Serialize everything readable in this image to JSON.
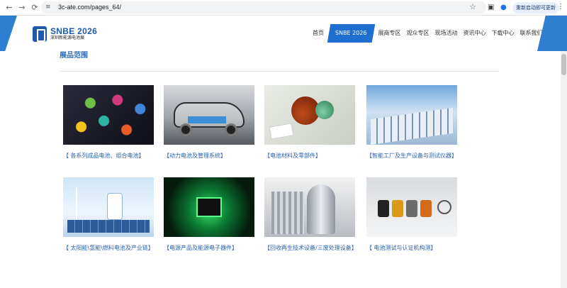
{
  "browser": {
    "back_icon": "←",
    "forward_icon": "→",
    "reload_icon": "⟳",
    "url": "3c-ate.com/pages_64/",
    "site_info_icon": "≡",
    "bookmark_icon": "☆",
    "update_label": "重新启动即可更新",
    "menu_icon": "⋮"
  },
  "header": {
    "logo_title": "SNBE 2026",
    "logo_subtitle": "深圳新能源电池展",
    "nav": [
      {
        "label": "首页"
      },
      {
        "label": "SNBE 2026"
      },
      {
        "label": "展商专区"
      },
      {
        "label": "观众专区"
      },
      {
        "label": "现场活动"
      },
      {
        "label": "资讯中心"
      },
      {
        "label": "下载中心"
      },
      {
        "label": "联系我们"
      }
    ],
    "accent_color": "#1e6fcf"
  },
  "main": {
    "section_title": "展品范围",
    "cards": [
      {
        "caption": "【 各系列成品电池、组合电池】",
        "image": "battery-cells-image"
      },
      {
        "caption": "【动力电池及管理系统】",
        "image": "ev-battery-image"
      },
      {
        "caption": "【电池材料及零部件】",
        "image": "battery-materials-image"
      },
      {
        "caption": "【智能工厂及生产设备与测试仪器】",
        "image": "smart-factory-image"
      },
      {
        "caption": "【 太阳能\\氢能\\燃料电池及产业链】",
        "image": "hydrogen-solar-image"
      },
      {
        "caption": "【电源产品及能源电子器件】",
        "image": "power-electronics-image"
      },
      {
        "caption": "【回收再生技术设备/三废处理设备】",
        "image": "recycling-equipment-image"
      },
      {
        "caption": "【 电池测试与认证机构测】",
        "image": "battery-testing-image"
      }
    ]
  }
}
